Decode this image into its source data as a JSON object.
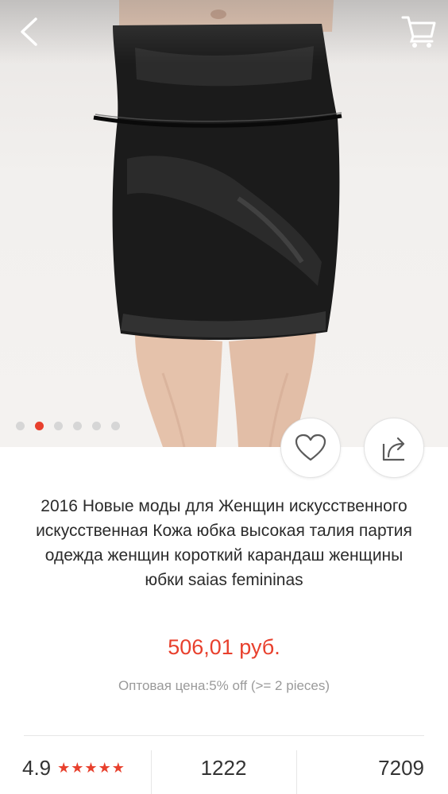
{
  "gallery": {
    "image_alt": "black faux leather pencil skirt",
    "dots_count": 6,
    "active_index": 1
  },
  "nav": {
    "back_icon": "chevron-left-icon",
    "cart_icon": "shopping-cart-icon"
  },
  "actions": {
    "wishlist_icon": "heart-icon",
    "share_icon": "share-icon"
  },
  "product": {
    "title": "2016 Новые моды для Женщин искусственного искусственная Кожа юбка высокая талия партия одежда женщин короткий карандаш женщины юбки saias femininas",
    "price": "506,01 руб.",
    "wholesale": "Оптовая цена:5% off (>= 2 pieces)"
  },
  "stats": {
    "rating": "4.9",
    "stars": "★★★★★",
    "orders": "1222",
    "wishes": "7209"
  },
  "colors": {
    "accent": "#e8402d",
    "muted_text": "#9a9a9a"
  }
}
